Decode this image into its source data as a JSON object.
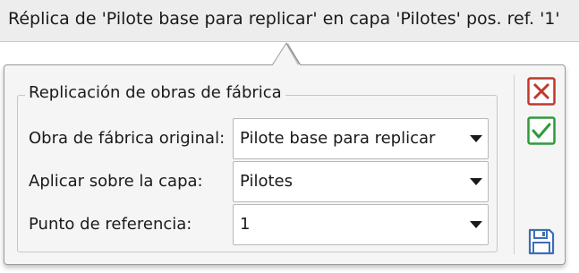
{
  "header": {
    "title": "Réplica de 'Pilote base para replicar' en capa 'Pilotes' pos. ref. '1'"
  },
  "group": {
    "legend": "Replicación de obras de fábrica"
  },
  "fields": [
    {
      "label": "Obra de fábrica original:",
      "value": "Pilote base para replicar"
    },
    {
      "label": "Aplicar sobre la capa:",
      "value": "Pilotes"
    },
    {
      "label": "Punto de referencia:",
      "value": "1"
    }
  ],
  "actions": {
    "cancel_icon": "close-icon",
    "accept_icon": "check-icon",
    "save_icon": "save-icon"
  },
  "colors": {
    "cancel": "#c0392b",
    "accept": "#2e9b3a",
    "save": "#3d6fb5"
  }
}
